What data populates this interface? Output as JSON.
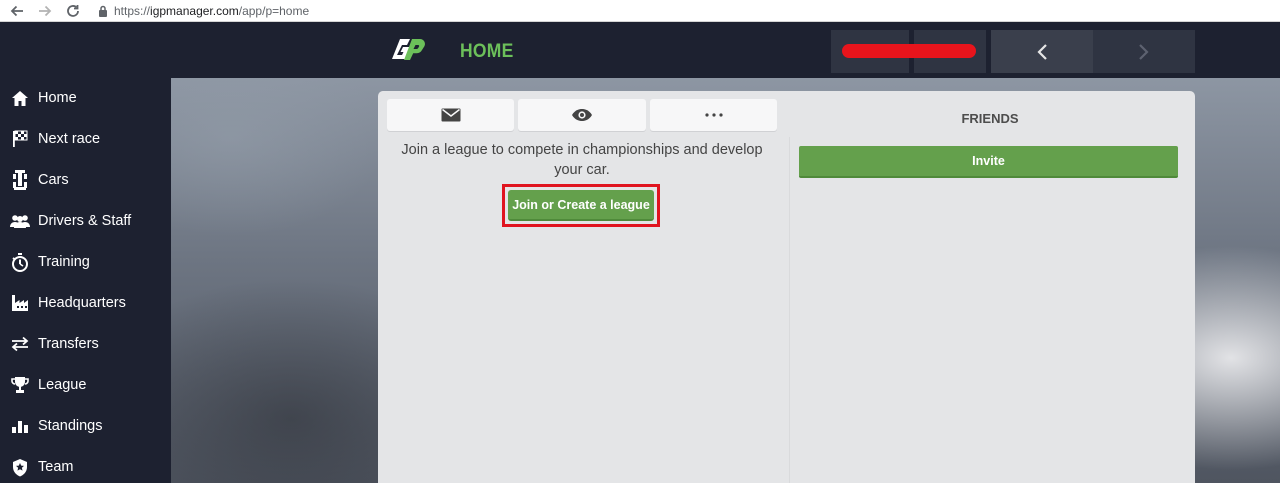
{
  "browser": {
    "url_scheme": "https://",
    "url_host": "igpmanager.com",
    "url_path": "/app/p=home",
    "back_icon": "arrow-left-icon",
    "forward_icon": "arrow-right-icon",
    "reload_icon": "reload-icon",
    "lock_icon": "lock-icon"
  },
  "header": {
    "title": "HOME",
    "logo": "igp-logo",
    "accent_color": "#6cc05a",
    "redaction_color": "#e8141c"
  },
  "sidebar": {
    "items": [
      {
        "label": "Home",
        "icon": "home-icon"
      },
      {
        "label": "Next race",
        "icon": "checkered-flag-icon"
      },
      {
        "label": "Cars",
        "icon": "car-icon"
      },
      {
        "label": "Drivers & Staff",
        "icon": "people-icon"
      },
      {
        "label": "Training",
        "icon": "stopwatch-icon"
      },
      {
        "label": "Headquarters",
        "icon": "factory-icon"
      },
      {
        "label": "Transfers",
        "icon": "transfer-arrows-icon"
      },
      {
        "label": "League",
        "icon": "trophy-icon"
      },
      {
        "label": "Standings",
        "icon": "bar-chart-icon"
      },
      {
        "label": "Team",
        "icon": "shield-star-icon"
      }
    ]
  },
  "main": {
    "tabs": [
      {
        "icon": "envelope-icon"
      },
      {
        "icon": "eye-icon"
      },
      {
        "icon": "ellipsis-icon"
      }
    ],
    "join_message": "Join a league to compete in championships and develop your car.",
    "join_button": "Join or Create a league",
    "highlight_color": "#e0141f",
    "button_color": "#64a04c"
  },
  "friends": {
    "title": "FRIENDS",
    "invite_button": "Invite"
  }
}
